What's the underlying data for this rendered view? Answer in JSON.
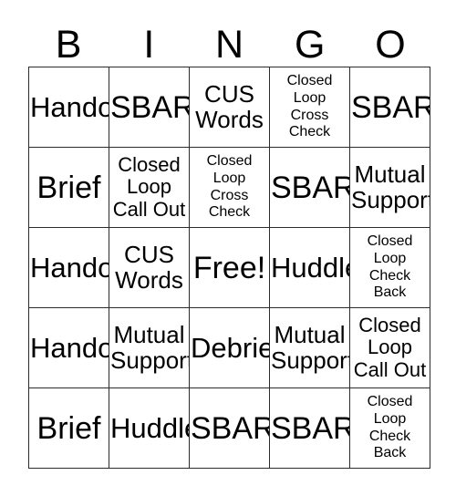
{
  "card": {
    "title": "BINGO",
    "header_letters": [
      "B",
      "I",
      "N",
      "G",
      "O"
    ],
    "columns": 5,
    "rows": 5,
    "border_color": "#2b2b2b",
    "cell_background": "#ffffff",
    "text_color": "#000000",
    "free_space_label": "Free!",
    "free_space_position": {
      "row": 3,
      "column": 3
    },
    "cells": [
      [
        {
          "text": "Handoff",
          "lines": 1,
          "size": "lg"
        },
        {
          "text": "SBAR",
          "lines": 1,
          "size": "xl"
        },
        {
          "text": "CUS\nWords",
          "lines": 2,
          "size": "md"
        },
        {
          "text": "Closed\nLoop\nCross\nCheck",
          "lines": 4,
          "size": "xs"
        },
        {
          "text": "SBAR",
          "lines": 1,
          "size": "xl"
        }
      ],
      [
        {
          "text": "Brief",
          "lines": 1,
          "size": "xl"
        },
        {
          "text": "Closed\nLoop\nCall Out",
          "lines": 3,
          "size": "sm"
        },
        {
          "text": "Closed\nLoop\nCross\nCheck",
          "lines": 4,
          "size": "xs"
        },
        {
          "text": "SBAR",
          "lines": 1,
          "size": "xl"
        },
        {
          "text": "Mutual\nSupport",
          "lines": 2,
          "size": "md"
        }
      ],
      [
        {
          "text": "Handoff",
          "lines": 1,
          "size": "lg"
        },
        {
          "text": "CUS\nWords",
          "lines": 2,
          "size": "md"
        },
        {
          "text": "Free!",
          "lines": 1,
          "size": "xl"
        },
        {
          "text": "Huddle",
          "lines": 1,
          "size": "lg"
        },
        {
          "text": "Closed\nLoop\nCheck\nBack",
          "lines": 4,
          "size": "xs"
        }
      ],
      [
        {
          "text": "Handoff",
          "lines": 1,
          "size": "lg"
        },
        {
          "text": "Mutual\nSupport",
          "lines": 2,
          "size": "md"
        },
        {
          "text": "Debrief",
          "lines": 1,
          "size": "lg"
        },
        {
          "text": "Mutual\nSupport",
          "lines": 2,
          "size": "md"
        },
        {
          "text": "Closed\nLoop\nCall Out",
          "lines": 3,
          "size": "sm"
        }
      ],
      [
        {
          "text": "Brief",
          "lines": 1,
          "size": "xl"
        },
        {
          "text": "Huddle",
          "lines": 1,
          "size": "lg"
        },
        {
          "text": "SBAR",
          "lines": 1,
          "size": "xl"
        },
        {
          "text": "SBAR",
          "lines": 1,
          "size": "xl"
        },
        {
          "text": "Closed\nLoop\nCheck\nBack",
          "lines": 4,
          "size": "xs"
        }
      ]
    ]
  }
}
